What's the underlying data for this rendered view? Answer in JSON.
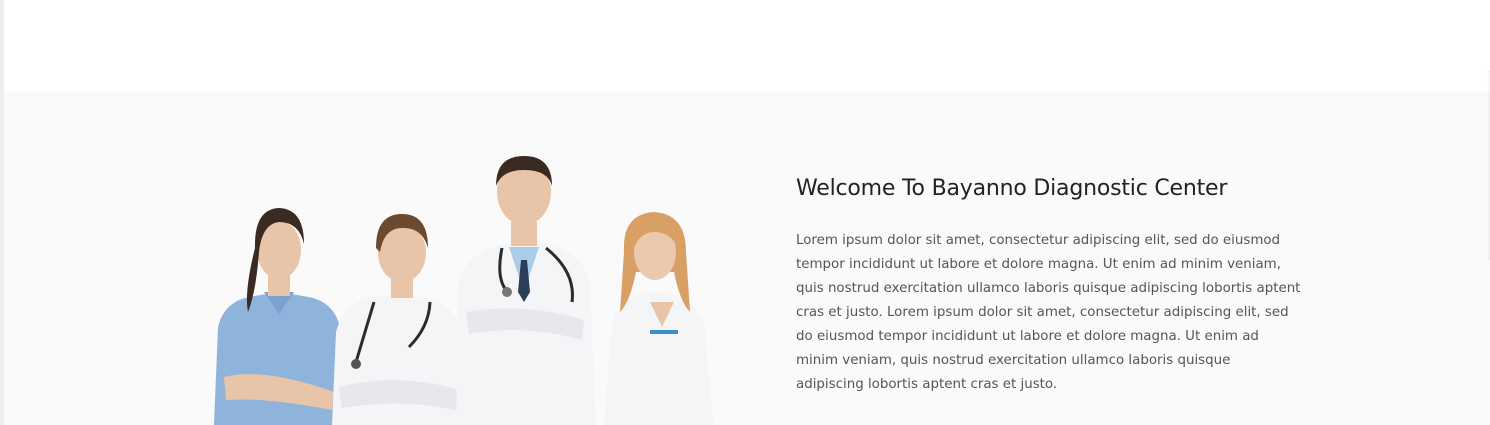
{
  "welcome": {
    "title": "Welcome To Bayanno Diagnostic Center",
    "body": "Lorem ipsum dolor sit amet, consectetur adipiscing elit, sed do eiusmod tempor incididunt ut labore et dolore magna. Ut enim ad minim veniam, quis nostrud exercitation ullamco laboris quisque adipiscing lobortis aptent cras et justo. Lorem ipsum dolor sit amet, consectetur adipiscing elit, sed do eiusmod tempor incididunt ut labore et dolore magna. Ut enim ad minim veniam, quis nostrud exercitation ullamco laboris quisque adipiscing lobortis aptent cras et justo."
  },
  "image": {
    "subject": "medical-team-photo",
    "colors": {
      "scrubs": "#8fb4dc",
      "coat": "#f4f5f7",
      "skin": "#e8c4a8",
      "hair_dark": "#3a2a22",
      "hair_blonde": "#d9a066",
      "stethoscope": "#2b2b2b"
    }
  },
  "colors": {
    "section_bg": "#fafafa",
    "title": "#222222",
    "body": "#555555"
  }
}
